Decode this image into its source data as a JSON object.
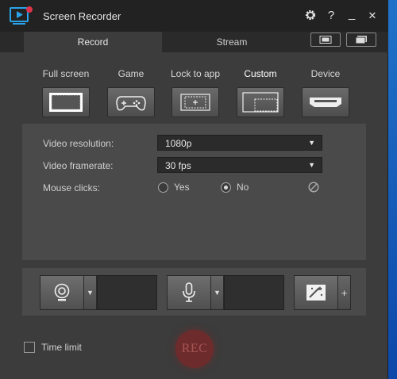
{
  "window": {
    "title": "Screen Recorder",
    "controls": {
      "settings_icon": "gear-icon",
      "help_label": "?",
      "minimize_label": "_",
      "close_label": "✕"
    }
  },
  "tabs": [
    {
      "label": "Record",
      "selected": true
    },
    {
      "label": "Stream",
      "selected": false
    }
  ],
  "capture_modes": [
    {
      "label": "Full screen",
      "icon": "full-screen-icon",
      "selected": false
    },
    {
      "label": "Game",
      "icon": "gamepad-icon",
      "selected": false
    },
    {
      "label": "Lock to app",
      "icon": "lock-to-app-icon",
      "selected": false
    },
    {
      "label": "Custom",
      "icon": "custom-area-icon",
      "selected": true
    },
    {
      "label": "Device",
      "icon": "device-icon",
      "selected": false
    }
  ],
  "settings": {
    "video_resolution": {
      "label": "Video resolution:",
      "value": "1080p"
    },
    "video_framerate": {
      "label": "Video framerate:",
      "value": "30 fps"
    },
    "mouse_clicks": {
      "label": "Mouse clicks:",
      "yes_label": "Yes",
      "no_label": "No",
      "selected": "No"
    }
  },
  "devices": {
    "webcam_icon": "webcam-icon",
    "microphone_icon": "microphone-icon",
    "effects_icon": "effects-icon",
    "add_label": "+"
  },
  "footer": {
    "time_limit_label": "Time limit",
    "time_limit_checked": false,
    "rec_label": "REC"
  },
  "colors": {
    "window_bg": "#3c3c3c",
    "titlebar_bg": "#222222",
    "panel_bg": "#4a4a4a",
    "rec_bg": "#6e2b2b",
    "logo_accent": "#2aa3e8"
  }
}
